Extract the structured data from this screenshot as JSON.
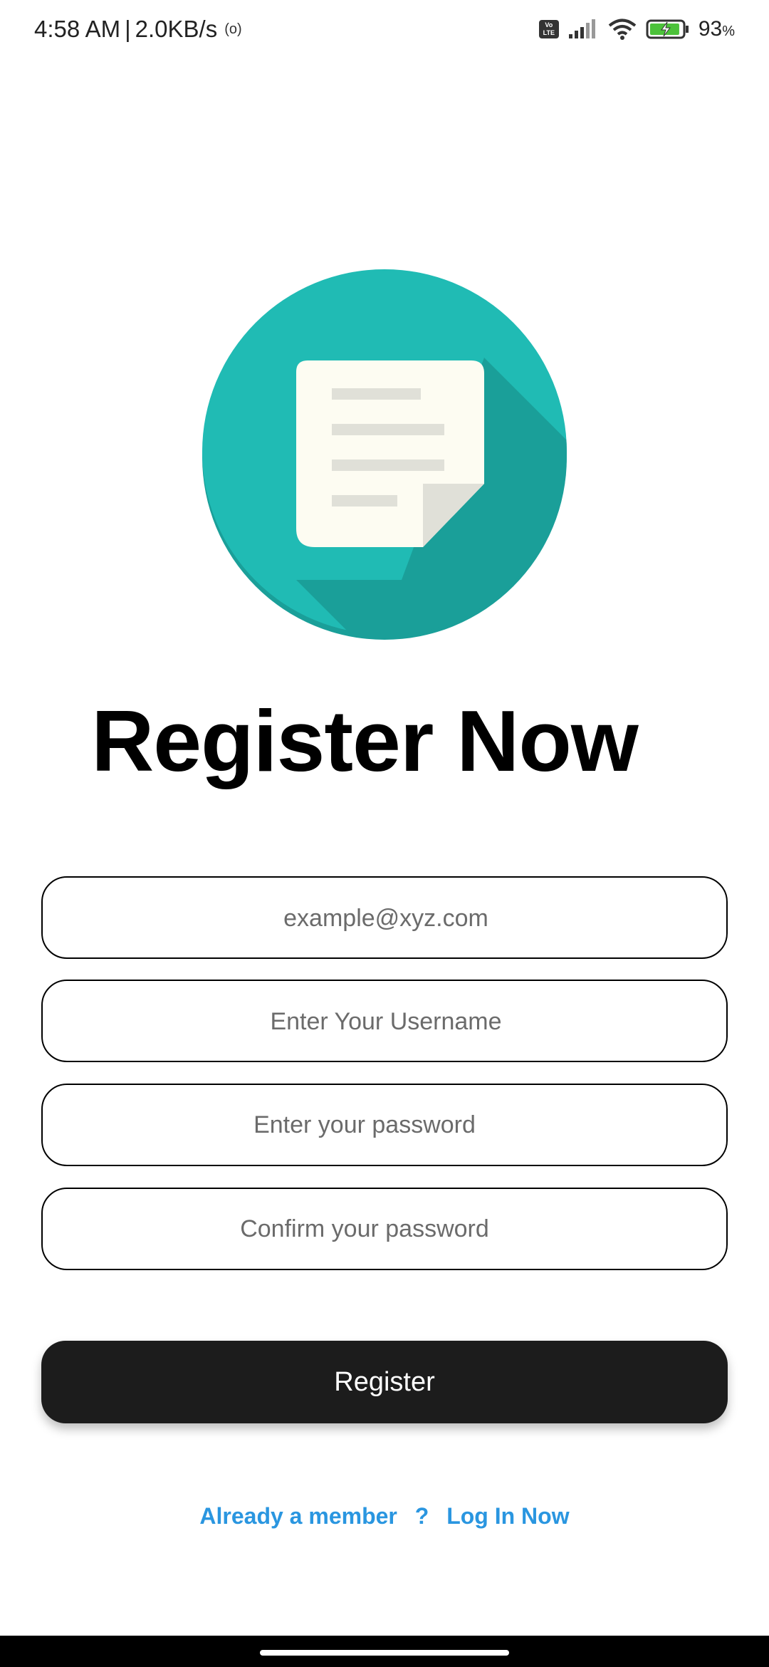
{
  "status_bar": {
    "time": "4:58 AM",
    "separator": "|",
    "speed": "2.0KB/s",
    "hotspot_glyph": "(o)",
    "volte_label": "Vo LTE",
    "battery_percent": "93",
    "battery_unit": "%",
    "battery_level": 0.93
  },
  "logo": {
    "icon": "document-icon",
    "circle_color": "#20bbb4",
    "shadow_color": "#1a9f99",
    "paper_color": "#fdfcf2",
    "lines_color": "#e0e0d8"
  },
  "page": {
    "title": "Register Now"
  },
  "form": {
    "email_placeholder": "example@xyz.com",
    "username_placeholder": "Enter Your Username",
    "password_placeholder": "Enter your password",
    "confirm_placeholder": "Confirm your password",
    "register_label": "Register"
  },
  "footer": {
    "already_member": "Already a member",
    "question_mark": "?",
    "login_link": "Log In Now",
    "link_color": "#2a96e0"
  }
}
